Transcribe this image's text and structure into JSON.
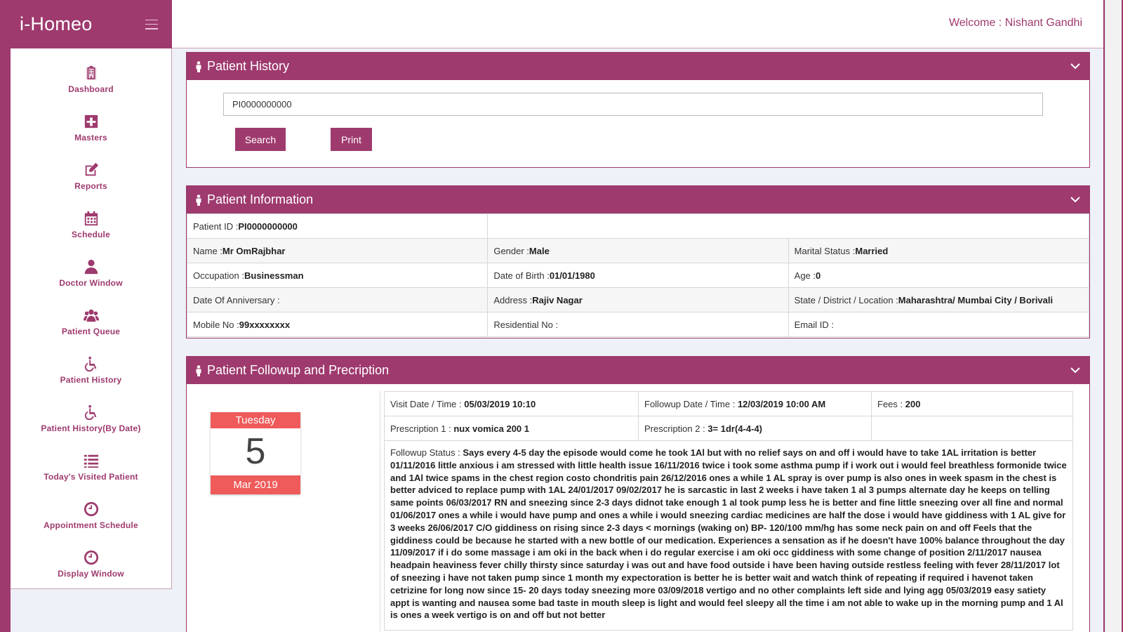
{
  "app": {
    "brand": "i-Homeo",
    "welcome_label": "Welcome : ",
    "user_name": "Nishant Gandhi"
  },
  "colors": {
    "brand": "#9e3a6e",
    "calendar": "#ef5a5a"
  },
  "sidebar": {
    "items": [
      {
        "label": "Dashboard",
        "icon": "hospital-icon"
      },
      {
        "label": "Masters",
        "icon": "plus-square-icon"
      },
      {
        "label": "Reports",
        "icon": "edit-icon"
      },
      {
        "label": "Schedule",
        "icon": "calendar-icon"
      },
      {
        "label": "Doctor Window",
        "icon": "doctor-icon"
      },
      {
        "label": "Patient Queue",
        "icon": "users-icon"
      },
      {
        "label": "Patient History",
        "icon": "wheelchair-icon"
      },
      {
        "label": "Patient History(By Date)",
        "icon": "wheelchair-icon"
      },
      {
        "label": "Today's Visited Patient",
        "icon": "list-icon"
      },
      {
        "label": "Appointment Schedule",
        "icon": "clock-icon"
      },
      {
        "label": "Display Window",
        "icon": "clock-icon"
      }
    ]
  },
  "history": {
    "title": "Patient History",
    "search_value": "PI0000000000",
    "search_button": "Search",
    "print_button": "Print"
  },
  "info": {
    "title": "Patient Information",
    "patient_id_label": "Patient ID :",
    "patient_id": "PI0000000000",
    "name_label": "Name :",
    "name": "Mr OmRajbhar",
    "gender_label": "Gender :",
    "gender": "Male",
    "marital_label": "Marital Status :",
    "marital": "Married",
    "occupation_label": "Occupation :",
    "occupation": "Businessman",
    "dob_label": "Date of Birth :",
    "dob": "01/01/1980",
    "age_label": "Age :",
    "age": "0",
    "anniversary_label": "Date Of Anniversary :",
    "anniversary": "",
    "address_label": "Address :",
    "address": "Rajiv Nagar",
    "state_label": "State / District / Location :",
    "state": "Maharashtra/ Mumbai City / Borivali",
    "mobile_label": "Mobile No :",
    "mobile": "99xxxxxxxx",
    "residential_label": "Residential No :",
    "residential": "",
    "email_label": "Email ID :",
    "email": ""
  },
  "followup": {
    "title": "Patient Followup and Precription",
    "calendar": {
      "weekday": "Tuesday",
      "day": "5",
      "month_year": "Mar 2019"
    },
    "visit_label": "Visit Date / Time : ",
    "visit": "05/03/2019 10:10",
    "followup_label": "Followup Date / Time : ",
    "followup": "12/03/2019 10:00 AM",
    "fees_label": "Fees : ",
    "fees": "200",
    "rx1_label": "Prescription 1 : ",
    "rx1": "nux vomica 200 1",
    "rx2_label": "Prescription 2 : ",
    "rx2": "3= 1dr(4-4-4)",
    "status_label": "Followup Status : ",
    "status": "Says every 4-5 day the episode would come he took 1Al but with no relief says on and off i would have to take 1AL irritation is better 01/11/2016 little anxious i am stressed with little health issue 16/11/2016 twice i took some asthma pump if i work out i would feel breathless formonide twice and 1Al twice spams in the chest region costo chondritis pain 26/12/2016 ones a while 1 AL spray is over pump is also ones in week spasm in the chest is better adviced to replace pump with 1AL 24/01/2017 09/02/2017 he is sarcastic in last 2 weeks i have taken 1 al 3 pumps alternate day he keeps on telling same points 06/03/2017 RN and sneezing since 2-3 days didnot take enough 1 al took pump less he is better and fine little sneezing over all fine and normal 01/06/2017 ones a while i would have pump and ones a while i would sneezing cardiac medicines are half the dose i would have giddiness with 1 AL give for 3 weeks 26/06/2017 C/O giddiness on rising since 2-3 days < mornings (waking on) BP- 120/100 mm/hg has some neck pain on and off Feels that the giddiness could be because he started with a new bottle of our medication. Experiences a sensation as if he doesn't have 100% balance throughout the day 11/09/2017 if i do some massage i am oki in the back when i do regular exercise i am oki occ giddiness with some change of position 2/11/2017 nausea headpain heaviness fever chilly thirsty since saturday i was out and have food outside i have been having outside restless feeling with fever 28/11/2017 lot of sneezing i have not taken pump since 1 month my expectoration is better he is better wait and watch think of repeating if required i havenot taken cetrizine for long now since 15- 20 days today sneezing more 03/09/2018 vertigo and no other complaints left side and lying agg 05/03/2019 easy satiety appt is wanting and nausea some bad taste in mouth sleep is light and would feel sleepy all the time i am not able to wake up in the morning pump and 1 Al is ones a week vertigo is on and off but not better"
  }
}
